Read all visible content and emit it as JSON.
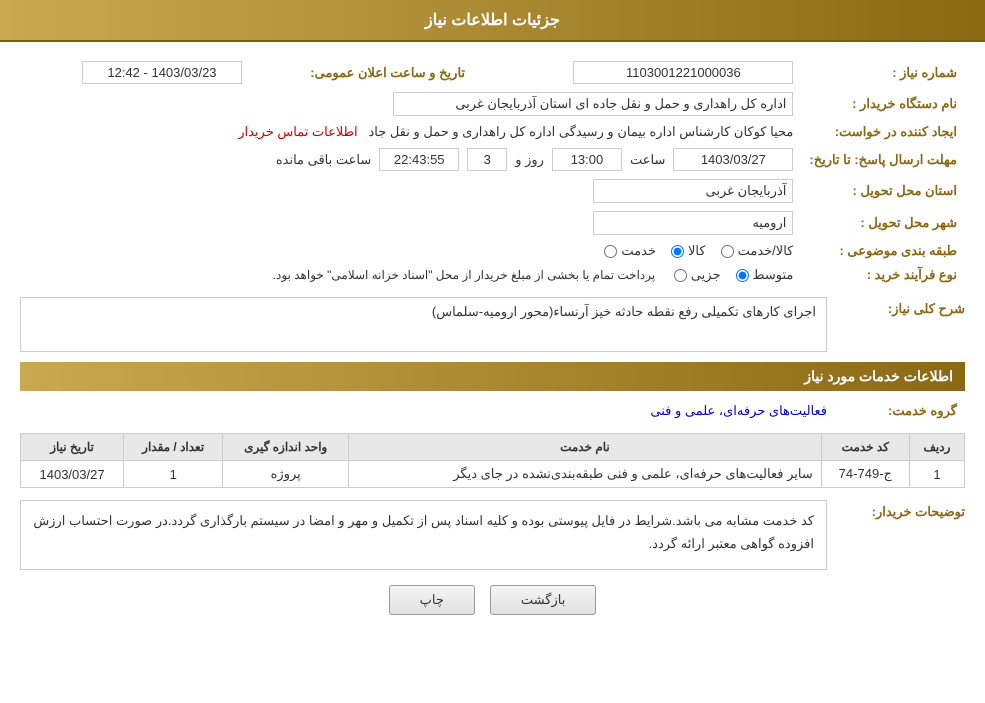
{
  "header": {
    "title": "جزئیات اطلاعات نیاز"
  },
  "fields": {
    "order_number_label": "شماره نیاز :",
    "order_number_value": "1103001221000036",
    "buyer_name_label": "نام دستگاه خریدار :",
    "buyer_name_value": "اداره کل راهداری و حمل و نقل جاده ای استان آذربایجان غربی",
    "creator_label": "ایجاد کننده در خواست:",
    "creator_value": "محیا کوکان کارشناس اداره بیمان و رسیدگی اداره کل راهداری و حمل و نقل جاد",
    "creator_link": "اطلاعات تماس خریدار",
    "deadline_label": "مهلت ارسال پاسخ: تا تاریخ:",
    "deadline_date": "1403/03/27",
    "deadline_time_label": "ساعت",
    "deadline_time": "13:00",
    "deadline_days_label": "روز و",
    "deadline_days": "3",
    "deadline_remaining": "22:43:55",
    "deadline_remaining_label": "ساعت باقی مانده",
    "announce_label": "تاریخ و ساعت اعلان عمومی:",
    "announce_value": "1403/03/23 - 12:42",
    "province_label": "استان محل تحویل :",
    "province_value": "آذربایجان غربی",
    "city_label": "شهر محل تحویل :",
    "city_value": "ارومیه",
    "category_label": "طبقه بندی موضوعی :",
    "category_options": [
      "خدمت",
      "کالا",
      "کالا/خدمت"
    ],
    "category_selected": "کالا",
    "purchase_type_label": "نوع فرآیند خرید :",
    "purchase_type_options": [
      "جزیی",
      "متوسط"
    ],
    "purchase_type_selected": "متوسط",
    "purchase_notice": "پرداخت تمام یا بخشی از مبلغ خریدار از محل \"اسناد خزانه اسلامی\" خواهد بود.",
    "need_desc_label": "شرح کلی نیاز:",
    "need_desc_value": "اجرای کارهای تکمیلی رفع نقطه حادثه خیز آرنساء(محور ارومیه-سلماس)",
    "services_header": "اطلاعات خدمات مورد نیاز",
    "service_group_label": "گروه خدمت:",
    "service_group_value": "فعالیت‌های حرفه‌ای، علمی و فنی",
    "table": {
      "cols": [
        "ردیف",
        "کد خدمت",
        "نام خدمت",
        "واحد اندازه گیری",
        "تعداد / مقدار",
        "تاریخ نیاز"
      ],
      "rows": [
        {
          "row": "1",
          "code": "ج-749-74",
          "name": "سایر فعالیت‌های حرفه‌ای، علمی و فنی طبقه‌بندی‌نشده در جای دیگر",
          "unit": "پروژه",
          "count": "1",
          "date": "1403/03/27"
        }
      ]
    },
    "buyer_desc_label": "توضیحات خریدار:",
    "buyer_desc_value": "کد خدمت مشابه می باشد.شرایط در فایل پیوستی بوده و کلیه اسناد پس از تکمیل و مهر و امضا در سیستم بارگذاری گردد.در صورت احتساب ارزش افزوده گواهی معتبر ارائه گردد.",
    "buttons": {
      "print": "چاپ",
      "back": "بازگشت"
    }
  }
}
